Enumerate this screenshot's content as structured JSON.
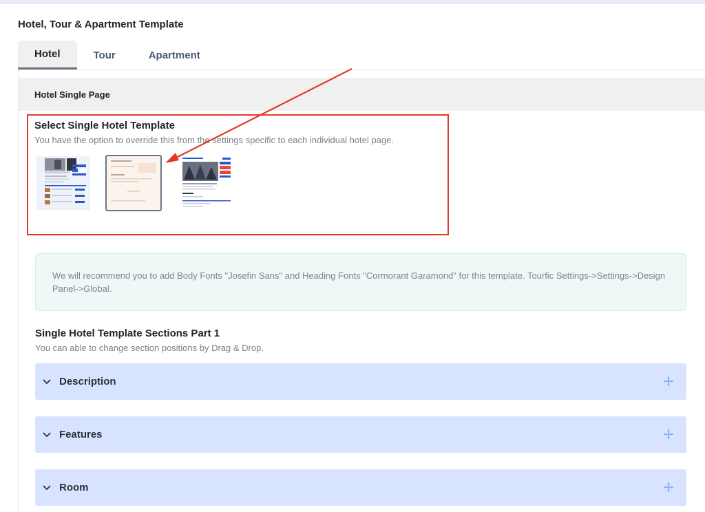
{
  "page": {
    "title": "Hotel, Tour & Apartment Template"
  },
  "tabs": [
    {
      "label": "Hotel",
      "active": true
    },
    {
      "label": "Tour",
      "active": false
    },
    {
      "label": "Apartment",
      "active": false
    }
  ],
  "panel": {
    "header": "Hotel Single Page",
    "select_title": "Select Single Hotel Template",
    "select_desc": "You have the option to override this from the settings specific to each individual hotel page.",
    "notice": "We will recommend you to add Body Fonts \"Josefin Sans\" and Heading Fonts \"Cormorant Garamond\" for this template. Tourfic Settings->Settings->Design Panel->Global.",
    "sections_title": "Single Hotel Template Sections Part 1",
    "sections_desc": "You can able to change section positions by Drag & Drop.",
    "sections": [
      {
        "label": "Description"
      },
      {
        "label": "Features"
      },
      {
        "label": "Room"
      }
    ]
  },
  "colors": {
    "accent_red": "#e33a27",
    "section_bg": "#d7e3ff",
    "move_icon": "#7aa7ee"
  }
}
